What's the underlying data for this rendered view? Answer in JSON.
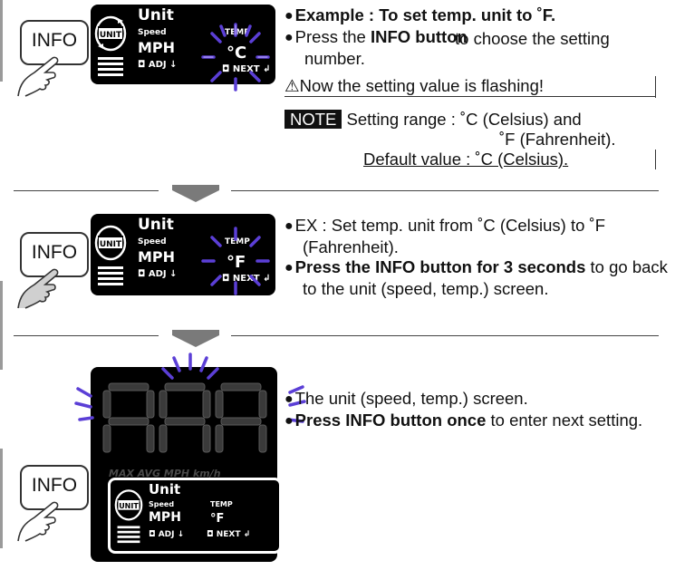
{
  "buttons": {
    "info_label": "INFO"
  },
  "lcd_small": {
    "title": "Unit",
    "speed_label": "Speed",
    "mph": "MPH",
    "temp_label": "TEMP",
    "adj": "ADJ",
    "next": "NEXT",
    "value_c": "°C",
    "value_f": "°F",
    "unit_logo": "UNIT"
  },
  "lcd_big": {
    "units_text": "MAX AVG   MPH km/h"
  },
  "section1": {
    "b1_bold": "Example : To set temp. unit to ˚F.",
    "b2_pre": "Press the ",
    "b2_bold": "INFO button",
    "b2_post": " to choose the setting number.",
    "warning": "Now the setting value is flashing!",
    "note_badge": "NOTE",
    "note_text1": "Setting range : ˚C (Celsius) and",
    "note_text2": "˚F (Fahrenheit).",
    "note_default": "Default value : ˚C (Celsius)."
  },
  "section2": {
    "b1": "EX : Set temp. unit from ˚C (Celsius) to ˚F (Fahrenheit).",
    "b2_bold": "Press the INFO button for 3 seconds",
    "b2_post": " to go back to the unit (speed, temp.) screen."
  },
  "section3": {
    "b1": "The unit (speed, temp.) screen.",
    "b2_bold": "Press INFO button once",
    "b2_post": " to enter next setting."
  },
  "colors": {
    "flash": "#5b3fd6",
    "lcd_bg": "#000000",
    "arrow": "#7a7a7a"
  }
}
